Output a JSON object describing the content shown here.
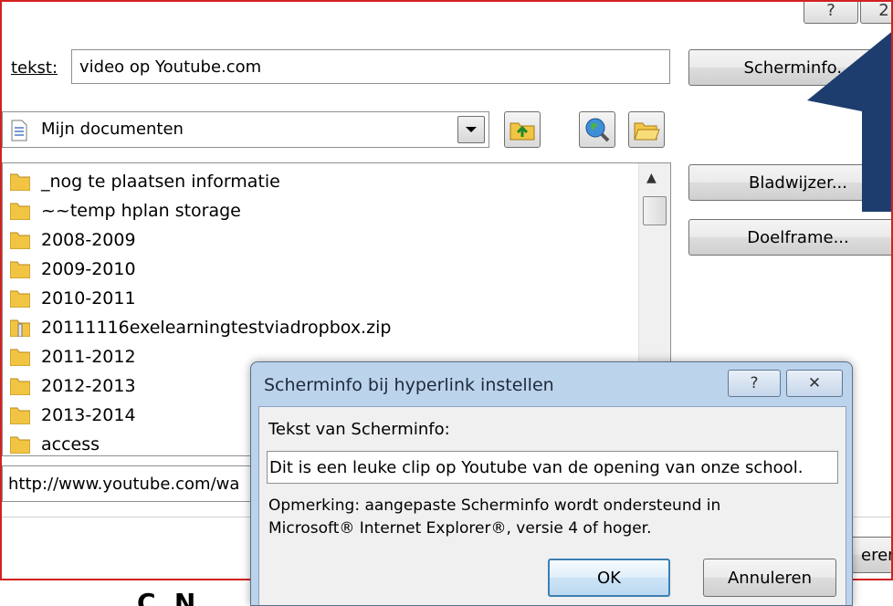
{
  "titlebar": {
    "help_label": "?",
    "close_partial": "2"
  },
  "link_text": {
    "label": "tekst:",
    "value": "video op Youtube.com"
  },
  "screentip_button": {
    "label": "Scherminfo..."
  },
  "location_combo": {
    "value": "Mijn documenten"
  },
  "files": [
    {
      "name": "_nog te plaatsen informatie",
      "type": "folder"
    },
    {
      "name": "~~temp hplan storage",
      "type": "folder"
    },
    {
      "name": "2008-2009",
      "type": "folder"
    },
    {
      "name": "2009-2010",
      "type": "folder"
    },
    {
      "name": "2010-2011",
      "type": "folder"
    },
    {
      "name": "20111116exelearningtestviadropbox.zip",
      "type": "zip"
    },
    {
      "name": "2011-2012",
      "type": "folder"
    },
    {
      "name": "2012-2013",
      "type": "folder"
    },
    {
      "name": "2013-2014",
      "type": "folder"
    },
    {
      "name": "access",
      "type": "folder"
    }
  ],
  "side_buttons": {
    "bookmark": "Bladwijzer...",
    "target_frame": "Doelframe..."
  },
  "address": {
    "value": "http://www.youtube.com/wa"
  },
  "partial_button": {
    "label": "eren"
  },
  "bottom_partial": {
    "text": "C. N"
  },
  "dialog": {
    "title": "Scherminfo bij hyperlink instellen",
    "help_label": "?",
    "close_label": "✕",
    "field_label": "Tekst van Scherminfo:",
    "field_value": "Dit is een leuke clip op Youtube van de opening van onze school.",
    "note_line1": "Opmerking: aangepaste Scherminfo wordt ondersteund in",
    "note_line2": "Microsoft® Internet Explorer®, versie 4 of hoger.",
    "ok_label": "OK",
    "cancel_label": "Annuleren"
  },
  "colors": {
    "border_red": "#d42020",
    "callout_navy": "#1d3d6e",
    "dialog_frame": "#bcd3ec"
  },
  "icons": {
    "combo": "document-icon",
    "up": "up-folder-icon",
    "web": "browse-web-icon",
    "browse": "browse-file-icon",
    "folder": "folder-icon",
    "zip": "zip-file-icon"
  }
}
